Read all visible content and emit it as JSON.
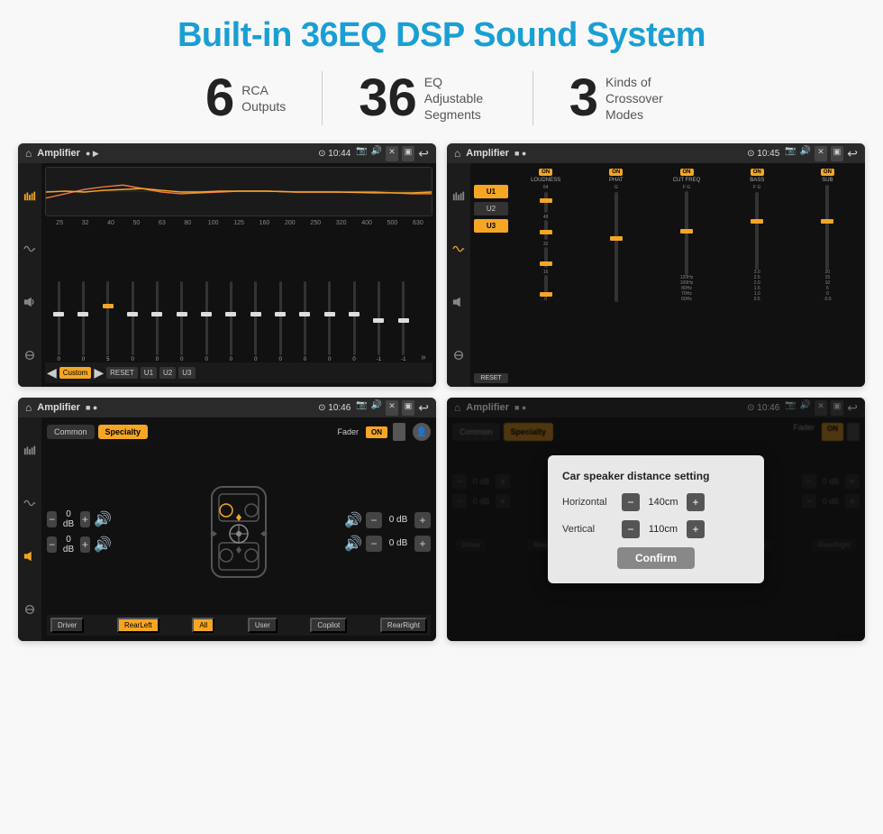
{
  "header": {
    "title": "Built-in 36EQ DSP Sound System"
  },
  "stats": [
    {
      "number": "6",
      "label": "RCA\nOutputs"
    },
    {
      "number": "36",
      "label": "EQ Adjustable\nSegments"
    },
    {
      "number": "3",
      "label": "Kinds of\nCrossover Modes"
    }
  ],
  "screens": [
    {
      "id": "screen1",
      "topbar": {
        "title": "Amplifier",
        "time": "10:44"
      },
      "eq_bands": [
        "25",
        "32",
        "40",
        "50",
        "63",
        "80",
        "100",
        "125",
        "160",
        "200",
        "250",
        "320",
        "400",
        "500",
        "630"
      ],
      "eq_values": [
        "0",
        "0",
        "0",
        "5",
        "0",
        "0",
        "0",
        "0",
        "0",
        "0",
        "0",
        "0",
        "0",
        "-1",
        "-1"
      ],
      "bottom_btns": [
        "Custom",
        "RESET",
        "U1",
        "U2",
        "U3"
      ]
    },
    {
      "id": "screen2",
      "topbar": {
        "title": "Amplifier",
        "time": "10:45"
      },
      "presets": [
        "U1",
        "U2",
        "U3"
      ],
      "channels": [
        {
          "name": "LOUDNESS",
          "on": true
        },
        {
          "name": "PHAT",
          "on": true
        },
        {
          "name": "CUT FREQ",
          "on": true
        },
        {
          "name": "BASS",
          "on": true
        },
        {
          "name": "SUB",
          "on": true
        }
      ]
    },
    {
      "id": "screen3",
      "topbar": {
        "title": "Amplifier",
        "time": "10:46"
      },
      "tabs": [
        "Common",
        "Specialty"
      ],
      "fader_label": "Fader",
      "fader_on": "ON",
      "vol_rows": [
        {
          "val": "0 dB"
        },
        {
          "val": "0 dB"
        },
        {
          "val": "0 dB"
        },
        {
          "val": "0 dB"
        }
      ],
      "bottom_btns": [
        "Driver",
        "RearLeft",
        "All",
        "User",
        "Copilot",
        "RearRight"
      ]
    },
    {
      "id": "screen4",
      "topbar": {
        "title": "Amplifier",
        "time": "10:46"
      },
      "dialog": {
        "title": "Car speaker distance setting",
        "rows": [
          {
            "label": "Horizontal",
            "value": "140cm"
          },
          {
            "label": "Vertical",
            "value": "110cm"
          }
        ],
        "confirm_label": "Confirm"
      },
      "tabs": [
        "Common",
        "Specialty"
      ],
      "fader_on": "ON"
    }
  ]
}
